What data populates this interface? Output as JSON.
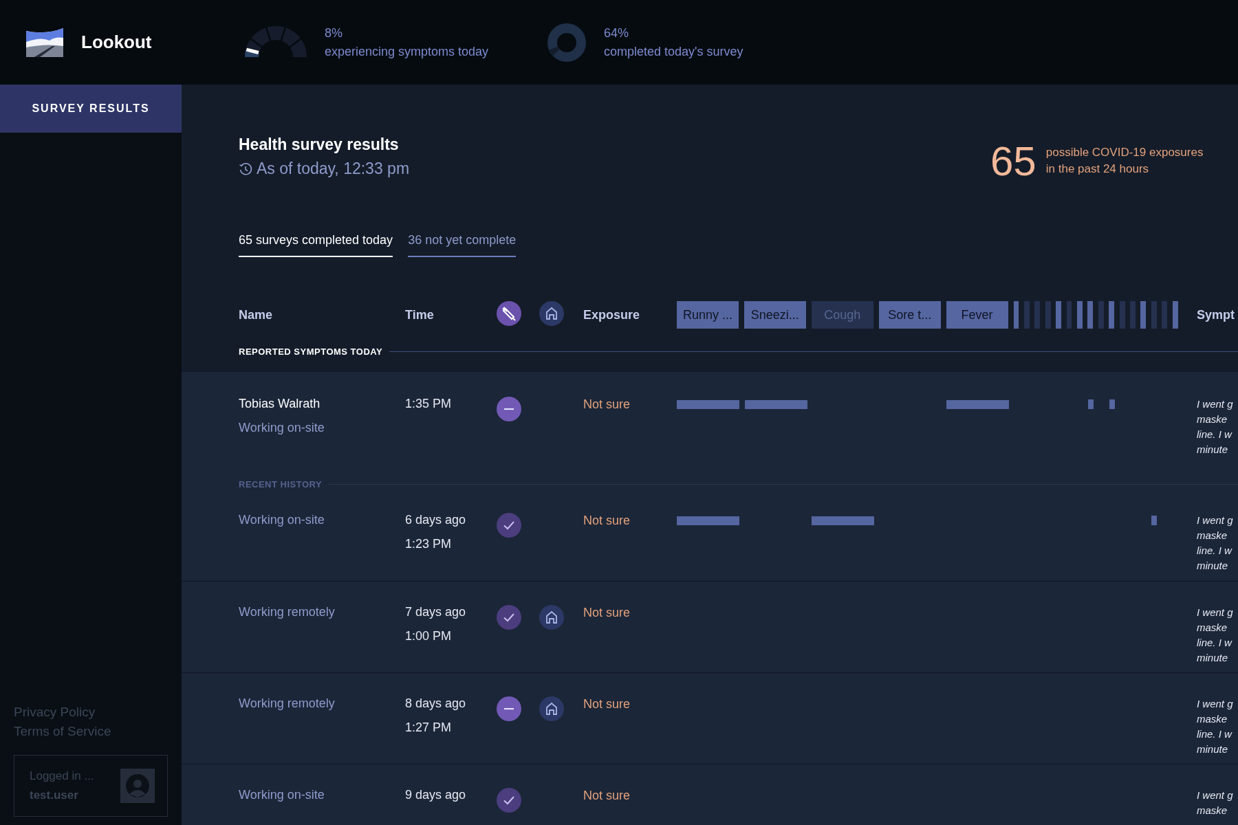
{
  "app": {
    "name": "Lookout"
  },
  "meters": [
    {
      "kind": "gauge",
      "level": 0.08,
      "value": "8%",
      "label": "experiencing symptoms today"
    },
    {
      "kind": "donut",
      "value": "64%",
      "label": "completed today's survey"
    }
  ],
  "sidebar": {
    "items": [
      {
        "label": "SURVEY RESULTS",
        "selected": true
      }
    ],
    "links": [
      "Privacy Policy",
      "Terms of Service"
    ],
    "user": {
      "caption": "Logged in ...",
      "name": "test.user"
    }
  },
  "header": {
    "title": "Health survey results",
    "updated": "As of today, 12:33 pm",
    "exposures": {
      "count": "65",
      "line_1": "possible COVID-19 exposures",
      "line_2": "in the past 24 hours"
    }
  },
  "tabs": [
    {
      "label": "65 surveys completed today",
      "selected": true
    },
    {
      "label": "36 not yet complete",
      "selected": false
    }
  ],
  "table": {
    "columns": {
      "name": "Name",
      "time": "Time",
      "exposure": "Exposure",
      "column_last": "Sympt"
    },
    "symptom_columns": [
      {
        "label": "Runny ...",
        "active": true
      },
      {
        "label": "Sneezi...",
        "active": true
      },
      {
        "label": "Cough",
        "active": false
      },
      {
        "label": "Sore t...",
        "active": true
      },
      {
        "label": "Fever",
        "active": true
      },
      {
        "active": true
      },
      {
        "active": false
      },
      {
        "active": false
      },
      {
        "active": false
      },
      {
        "active": true
      },
      {
        "active": false
      },
      {
        "active": true
      },
      {
        "active": true
      },
      {
        "active": false
      },
      {
        "active": true
      },
      {
        "active": false
      },
      {
        "active": false
      },
      {
        "active": true
      },
      {
        "active": false
      },
      {
        "active": false
      },
      {
        "active": true
      }
    ],
    "sections": [
      {
        "label": "REPORTED SYMPTOMS TODAY",
        "kind": "today",
        "rows": [
          {
            "name": "Tobias Walrath",
            "location": "Working on-site",
            "time": [
              "1:35 PM"
            ],
            "kind": "minus",
            "remote": false,
            "exposure": "Not sure",
            "symptoms": [
              true,
              true,
              false,
              false,
              true,
              false,
              false,
              false,
              false,
              false,
              false,
              false,
              true,
              false,
              true,
              false,
              false,
              false,
              false,
              false,
              false
            ],
            "note": [
              "I went g",
              "maske",
              "line. I w",
              "minute"
            ]
          }
        ]
      },
      {
        "label": "RECENT HISTORY",
        "kind": "history",
        "rows": [
          {
            "location": "Working on-site",
            "time": [
              "6 days ago",
              "1:23 PM"
            ],
            "kind": "check",
            "remote": false,
            "exposure": "Not sure",
            "symptoms": [
              true,
              false,
              true,
              false,
              false,
              false,
              false,
              false,
              false,
              false,
              false,
              false,
              false,
              false,
              false,
              false,
              false,
              false,
              true,
              false,
              false
            ],
            "note": [
              "I went g",
              "maske",
              "line. I w",
              "minute"
            ]
          },
          {
            "location": "Working remotely",
            "time": [
              "7 days ago",
              "1:00 PM"
            ],
            "kind": "check",
            "remote": true,
            "exposure": "Not sure",
            "symptoms": [
              false,
              false,
              false,
              false,
              false,
              false,
              false,
              false,
              false,
              false,
              false,
              false,
              false,
              false,
              false,
              false,
              false,
              false,
              false,
              false,
              false
            ],
            "note": [
              "I went g",
              "maske",
              "line. I w",
              "minute"
            ]
          },
          {
            "location": "Working remotely",
            "time": [
              "8 days ago",
              "1:27 PM"
            ],
            "kind": "minus",
            "remote": true,
            "exposure": "Not sure",
            "symptoms": [
              false,
              false,
              false,
              false,
              false,
              false,
              false,
              false,
              false,
              false,
              false,
              false,
              false,
              false,
              false,
              false,
              false,
              false,
              false,
              false,
              false
            ],
            "note": [
              "I went g",
              "maske",
              "line. I w",
              "minute"
            ]
          },
          {
            "location": "Working on-site",
            "time": [
              "9 days ago"
            ],
            "kind": "check",
            "remote": false,
            "exposure": "Not sure",
            "symptoms": [
              false,
              false,
              false,
              false,
              false,
              false,
              false,
              false,
              false,
              false,
              false,
              false,
              false,
              false,
              false,
              false,
              false,
              false,
              false,
              false,
              false
            ],
            "note": [
              "I went g",
              "maske"
            ]
          }
        ]
      }
    ]
  }
}
